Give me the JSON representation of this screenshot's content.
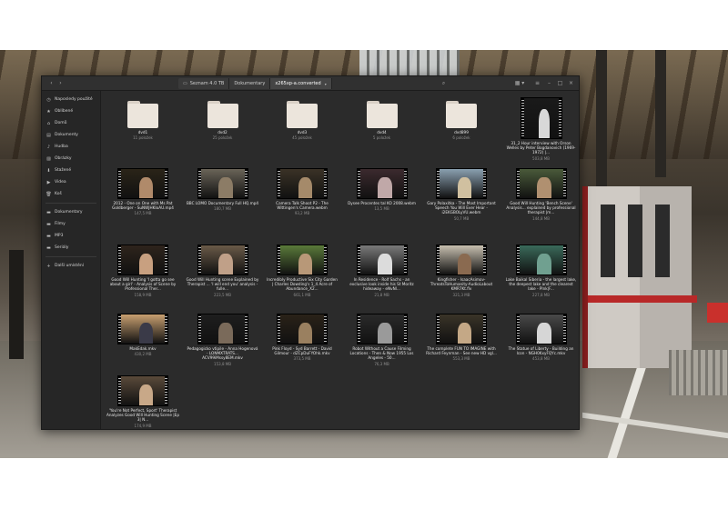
{
  "header": {
    "path": [
      {
        "label": "Seznam 4.0 TB",
        "icon": "drive-icon"
      },
      {
        "label": "Dokumentary",
        "icon": ""
      },
      {
        "label": "x265xp-a.converted",
        "icon": "",
        "caret": "▾"
      }
    ]
  },
  "sidebar": {
    "items": [
      {
        "label": "Naposledy použité",
        "icon": "clock-icon",
        "glyph": "◷"
      },
      {
        "label": "Oblíbené",
        "icon": "star-icon",
        "glyph": "★"
      },
      {
        "label": "Domů",
        "icon": "home-icon",
        "glyph": "⌂"
      },
      {
        "label": "Dokumenty",
        "icon": "document-icon",
        "glyph": "▤"
      },
      {
        "label": "Hudba",
        "icon": "music-icon",
        "glyph": "♪"
      },
      {
        "label": "Obrázky",
        "icon": "picture-icon",
        "glyph": "▨"
      },
      {
        "label": "Stažené",
        "icon": "download-icon",
        "glyph": "⬇"
      },
      {
        "label": "Videa",
        "icon": "video-icon",
        "glyph": "▶"
      },
      {
        "label": "Koš",
        "icon": "trash-icon",
        "glyph": "🗑"
      }
    ],
    "bookmarks": [
      {
        "label": "Dokumentary",
        "icon": "folder-icon",
        "glyph": "▬"
      },
      {
        "label": "Filmy",
        "icon": "folder-icon",
        "glyph": "▬"
      },
      {
        "label": "MP3",
        "icon": "folder-icon",
        "glyph": "▬"
      },
      {
        "label": "Seriály",
        "icon": "folder-icon",
        "glyph": "▬"
      }
    ],
    "other": {
      "label": "Další umístění",
      "icon": "plus-icon",
      "glyph": "+"
    }
  },
  "items": [
    {
      "kind": "folder",
      "name": "dvd1",
      "info": "11 položek"
    },
    {
      "kind": "folder",
      "name": "dvd2",
      "info": "25 položek"
    },
    {
      "kind": "folder",
      "name": "dvd3",
      "info": "45 položek"
    },
    {
      "kind": "folder",
      "name": "dvd4",
      "info": "5 položek"
    },
    {
      "kind": "folder",
      "name": "dvd899",
      "info": "6 položek"
    },
    {
      "kind": "video",
      "name": "31_2 Hour interview with Orson Welles by Peter Bogdanovich (1969-1972) |...",
      "info": "503,8 MB",
      "bg": "#1a1a1a",
      "fig": "#d8d8d8"
    },
    {
      "kind": "video",
      "name": "2012 - One on One with Ms Pat Goldberger - SuNWJHKIoAU.mp4",
      "info": "147,5 MB",
      "bg": "#2a2418",
      "fig": "#b08a6a"
    },
    {
      "kind": "video",
      "name": "BBC LOMO Documentary Full HQ.mp4",
      "info": "180,7 MB",
      "bg": "#6a6458",
      "fig": "#8c7c66"
    },
    {
      "kind": "video",
      "name": "Camera Talk Shoot P2 - The Wittingen's Camera.webm",
      "info": "93,2 MB",
      "bg": "#3a3226",
      "fig": "#a58a6a"
    },
    {
      "kind": "video",
      "name": "Dysee Procentes tal KO 2008.webm",
      "info": "13,5 MB",
      "bg": "#3c2a2e",
      "fig": "#c0a8a8"
    },
    {
      "kind": "video",
      "name": "Gary Polaxitka - The Most Important Speech You Will Ever Hear - i2EKGBOLyVU.webm",
      "info": "50,7 MB",
      "bg": "#8aa0b0",
      "fig": "#d0c0a0"
    },
    {
      "kind": "video",
      "name": "Good Will Hunting 'Bench Scene' Analysis... explained by professional therapist |m...",
      "info": "144,8 MB",
      "bg": "#4a5a3a",
      "fig": "#b09070"
    },
    {
      "kind": "video",
      "name": "Good Will Hunting 'I gotta go see about a girl' - Analysis of Scene by Professional Ther...",
      "info": "158,9 MB",
      "bg": "#2e241c",
      "fig": "#c8a080"
    },
    {
      "kind": "video",
      "name": "Good Will Hunting scene Explained by Therapist ... 'I will end you' analysis - fulle...",
      "info": "223,5 MB",
      "bg": "#6a5a48",
      "fig": "#c0a088"
    },
    {
      "kind": "video",
      "name": "Incredibly Productive Six City Garden | Charles Dowding's 1_4 Acre of Abundance_X2...",
      "info": "661,1 MB",
      "bg": "#5a7a3a",
      "fig": "#b89878"
    },
    {
      "kind": "video",
      "name": "In Residence - Rolf Sachs - an exclusive look inside his St Moritz hideaway - eNvNl...",
      "info": "21,8 MB",
      "bg": "#7a7a7a",
      "fig": "#dcdcdc"
    },
    {
      "kind": "video",
      "name": "Kingfisher - IsaacAsimov-ThreatsToHumanity-AudioLabout KMR7Kt.flv",
      "info": "321,3 MB",
      "bg": "#c8c0b0",
      "fig": "#8a6a50"
    },
    {
      "kind": "video",
      "name": "Lake Baikal Siberia - the largest lake, the deepest lake and the clearest lake - Plnk|F...",
      "info": "227,8 MB",
      "bg": "#3a6a5a",
      "fig": "#70a090"
    },
    {
      "kind": "video",
      "name": "MakEdak.mkv",
      "info": "430,2 MB",
      "bg": "#c8a070",
      "fig": "#3a3a48"
    },
    {
      "kind": "video",
      "name": "Pedagogicko vtipile - Anna Hogenová - LONMXTRATS... ACV99iMssy8EM.mkv",
      "info": "153,8 MB",
      "bg": "#1e1e1e",
      "fig": "#7a6a5a"
    },
    {
      "kind": "video",
      "name": "Pink Floyd - Syd Barrett - David Gilmour - dZCpDuFYOhk.mkv",
      "info": "373,5 MB",
      "bg": "#2a2218",
      "fig": "#9a8060"
    },
    {
      "kind": "video",
      "name": "Robot Without a Cause Filming Locations - Then & Now 1955 Los Angeles - 50...",
      "info": "76,3 MB",
      "bg": "#2a2a2a",
      "fig": "#9a9a9a"
    },
    {
      "kind": "video",
      "name": "The complete FUN TO IMAGINE with Richard Feynman - See new HD vgl...",
      "info": "553,3 MB",
      "bg": "#3a3428",
      "fig": "#c4a886"
    },
    {
      "kind": "video",
      "name": "The Statue of Liberty - Building an Icon - NGH0KxyFQYc.mkv",
      "info": "453,8 MB",
      "bg": "#4a4a4a",
      "fig": "#d6d6d6"
    },
    {
      "kind": "video",
      "name": "'You're Not Perfect, Sport' Therapist Analyzes Good Will Hunting Scene |Ep 3| N...",
      "info": "174,9 MB",
      "bg": "#5a4a3a",
      "fig": "#c8a888"
    }
  ]
}
